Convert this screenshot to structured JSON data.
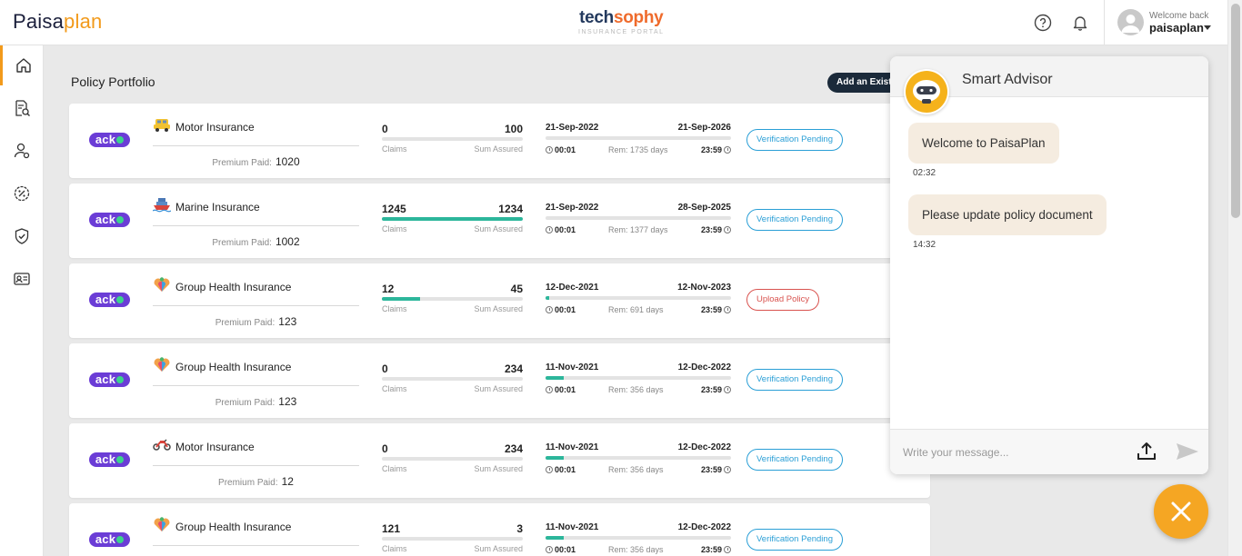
{
  "header": {
    "logo_part1": "Paisa",
    "logo_part2": "plan",
    "brand_part1": "tech",
    "brand_part2": "sophy",
    "brand_subtitle": "INSURANCE PORTAL",
    "welcome": "Welcome back",
    "username": "paisaplan",
    "icons": [
      "help-icon",
      "bell-icon",
      "avatar-icon",
      "chevron-down-icon"
    ]
  },
  "sidebar": {
    "items": [
      {
        "icon": "home-icon",
        "active": true
      },
      {
        "icon": "policy-search-icon",
        "active": false
      },
      {
        "icon": "user-settings-icon",
        "active": false
      },
      {
        "icon": "percent-badge-icon",
        "active": false
      },
      {
        "icon": "shield-check-icon",
        "active": false
      },
      {
        "icon": "id-card-icon",
        "active": false
      }
    ]
  },
  "main": {
    "section_title": "Policy Portfolio",
    "add_button": "Add an Existing Policy",
    "claims_label": "Claims",
    "sum_label": "Sum Assured",
    "premium_label": "Premium Paid:",
    "policies": [
      {
        "insurer": "acko",
        "icon": "car-icon",
        "name": "Motor Insurance",
        "premium": "1020",
        "claims": "0",
        "sum_assured": "100",
        "claims_ratio": 0,
        "start_date": "21-Sep-2022",
        "end_date": "21-Sep-2026",
        "start_time": "00:01",
        "end_time": "23:59",
        "remaining": "Rem: 1735 days",
        "elapsed_ratio": 0,
        "status": "Verification Pending",
        "status_type": "info"
      },
      {
        "insurer": "acko",
        "icon": "ship-icon",
        "name": "Marine Insurance",
        "premium": "1002",
        "claims": "1245",
        "sum_assured": "1234",
        "claims_ratio": 1,
        "start_date": "21-Sep-2022",
        "end_date": "28-Sep-2025",
        "start_time": "00:01",
        "end_time": "23:59",
        "remaining": "Rem: 1377 days",
        "elapsed_ratio": 0,
        "status": "Verification Pending",
        "status_type": "info"
      },
      {
        "insurer": "acko",
        "icon": "health-heart-icon",
        "name": "Group Health Insurance",
        "premium": "123",
        "claims": "12",
        "sum_assured": "45",
        "claims_ratio": 0.27,
        "start_date": "12-Dec-2021",
        "end_date": "12-Nov-2023",
        "start_time": "00:01",
        "end_time": "23:59",
        "remaining": "Rem: 691 days",
        "elapsed_ratio": 0.02,
        "status": "Upload Policy",
        "status_type": "warn"
      },
      {
        "insurer": "acko",
        "icon": "health-heart-icon",
        "name": "Group Health Insurance",
        "premium": "123",
        "claims": "0",
        "sum_assured": "234",
        "claims_ratio": 0,
        "start_date": "11-Nov-2021",
        "end_date": "12-Dec-2022",
        "start_time": "00:01",
        "end_time": "23:59",
        "remaining": "Rem: 356 days",
        "elapsed_ratio": 0.1,
        "status": "Verification Pending",
        "status_type": "info"
      },
      {
        "insurer": "acko",
        "icon": "motorbike-icon",
        "name": "Motor Insurance",
        "premium": "12",
        "claims": "0",
        "sum_assured": "234",
        "claims_ratio": 0,
        "start_date": "11-Nov-2021",
        "end_date": "12-Dec-2022",
        "start_time": "00:01",
        "end_time": "23:59",
        "remaining": "Rem: 356 days",
        "elapsed_ratio": 0.1,
        "status": "Verification Pending",
        "status_type": "info"
      },
      {
        "insurer": "acko",
        "icon": "health-heart-icon",
        "name": "Group Health Insurance",
        "premium": "",
        "claims": "121",
        "sum_assured": "3",
        "claims_ratio": 0,
        "start_date": "11-Nov-2021",
        "end_date": "12-Dec-2022",
        "start_time": "00:01",
        "end_time": "23:59",
        "remaining": "Rem: 356 days",
        "elapsed_ratio": 0.1,
        "status": "Verification Pending",
        "status_type": "info"
      }
    ]
  },
  "chat": {
    "title": "Smart Advisor",
    "messages": [
      {
        "text": "Welcome to PaisaPlan",
        "time": "02:32"
      },
      {
        "text": "Please update policy document",
        "time": "14:32"
      }
    ],
    "input_placeholder": "Write your message..."
  },
  "colors": {
    "accent": "#f29a1b",
    "progress": "#2cb69b",
    "status_info": "#2a9fd6",
    "status_warn": "#d9534f",
    "insurer_brand": "#6b3dd6",
    "dark_button": "#1b2a3a"
  }
}
